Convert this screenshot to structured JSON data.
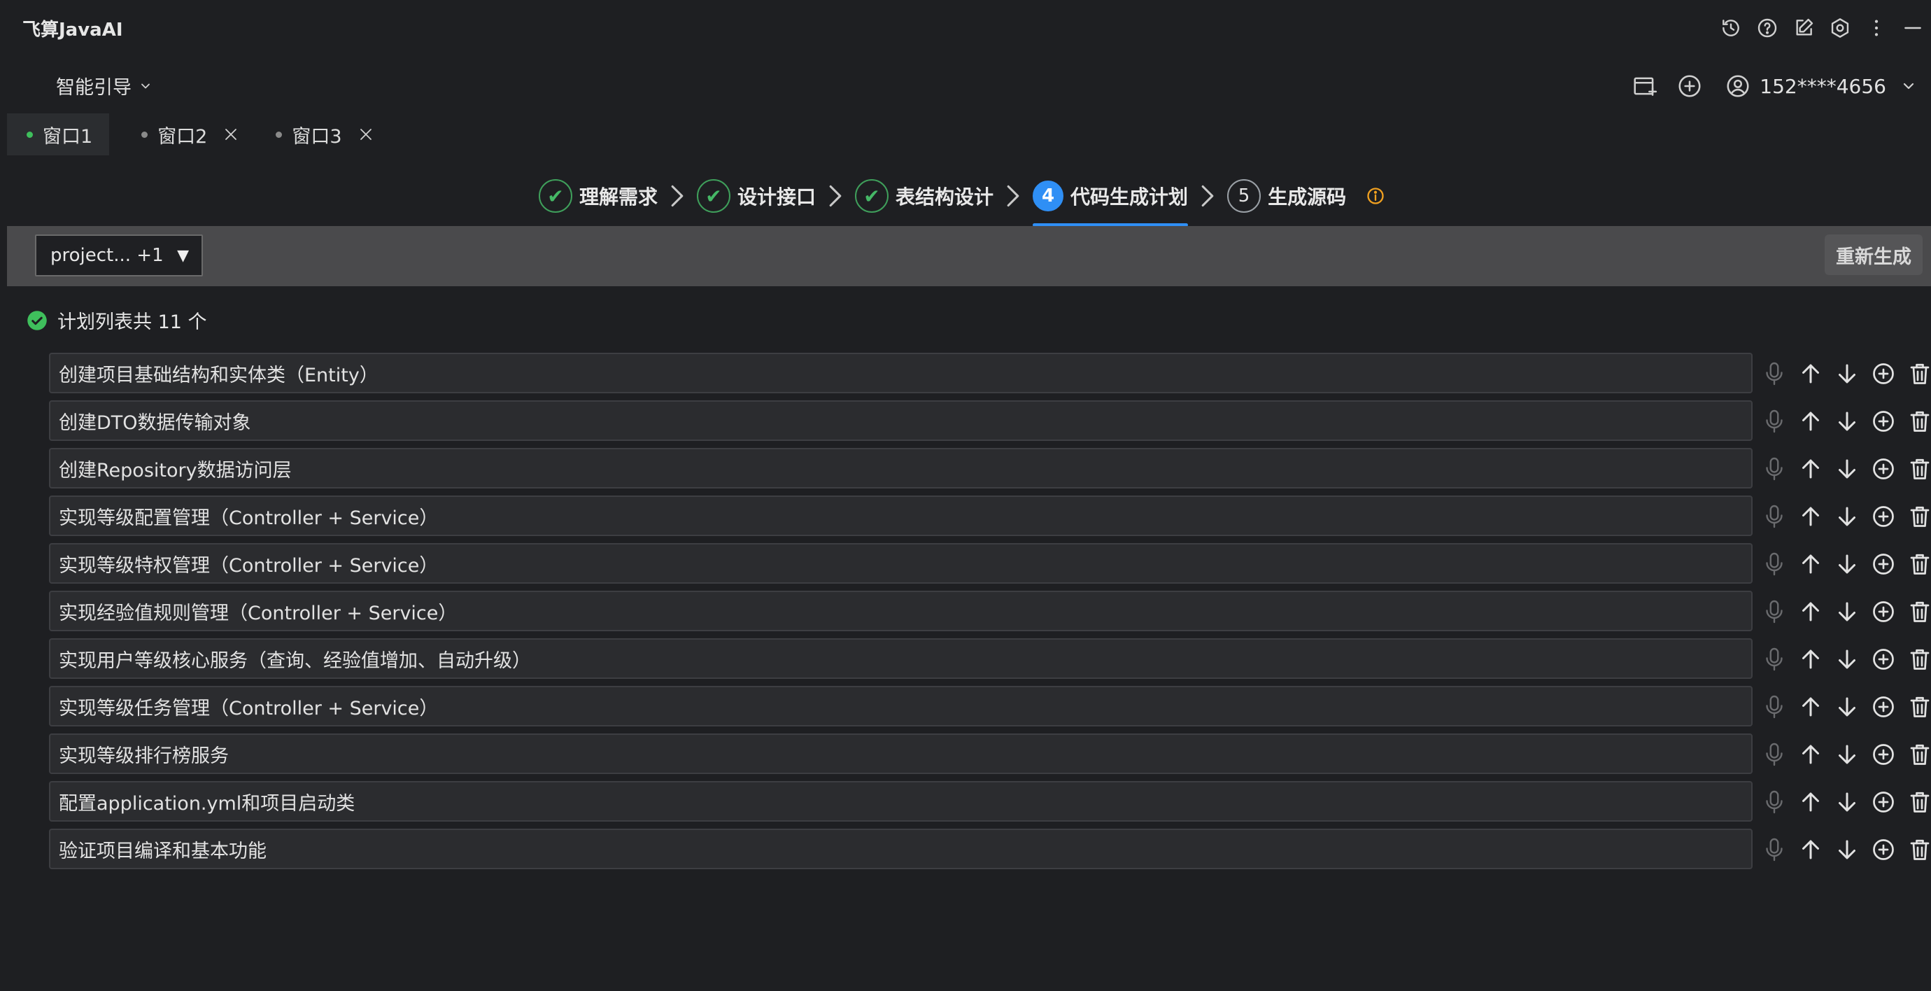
{
  "app": {
    "title": "飞算JavaAI"
  },
  "header": {
    "guide_label": "智能引导",
    "user_label": "152****4656"
  },
  "tabs": [
    {
      "label": "窗口1",
      "active": true
    },
    {
      "label": "窗口2",
      "active": false
    },
    {
      "label": "窗口3",
      "active": false
    }
  ],
  "steps": [
    {
      "num": "✔",
      "label": "理解需求",
      "state": "done"
    },
    {
      "num": "✔",
      "label": "设计接口",
      "state": "done"
    },
    {
      "num": "✔",
      "label": "表结构设计",
      "state": "done"
    },
    {
      "num": "4",
      "label": "代码生成计划",
      "state": "current"
    },
    {
      "num": "5",
      "label": "生成源码",
      "state": "pending"
    }
  ],
  "toolbar": {
    "project_select": "project... +1",
    "select_arrow": "▼",
    "regenerate_label": "重新生成"
  },
  "summary": {
    "text": "计划列表共 11 个"
  },
  "plan_items": [
    "创建项目基础结构和实体类（Entity）",
    "创建DTO数据传输对象",
    "创建Repository数据访问层",
    "实现等级配置管理（Controller + Service）",
    "实现等级特权管理（Controller + Service）",
    "实现经验值规则管理（Controller + Service）",
    "实现用户等级核心服务（查询、经验值增加、自动升级）",
    "实现等级任务管理（Controller + Service）",
    "实现等级排行榜服务",
    "配置application.yml和项目启动类",
    "验证项目编译和基本功能"
  ],
  "colors": {
    "background": "#1e1f22",
    "accent": "#2f8ff5",
    "success": "#3fbf5c",
    "warning": "#f0a020"
  }
}
